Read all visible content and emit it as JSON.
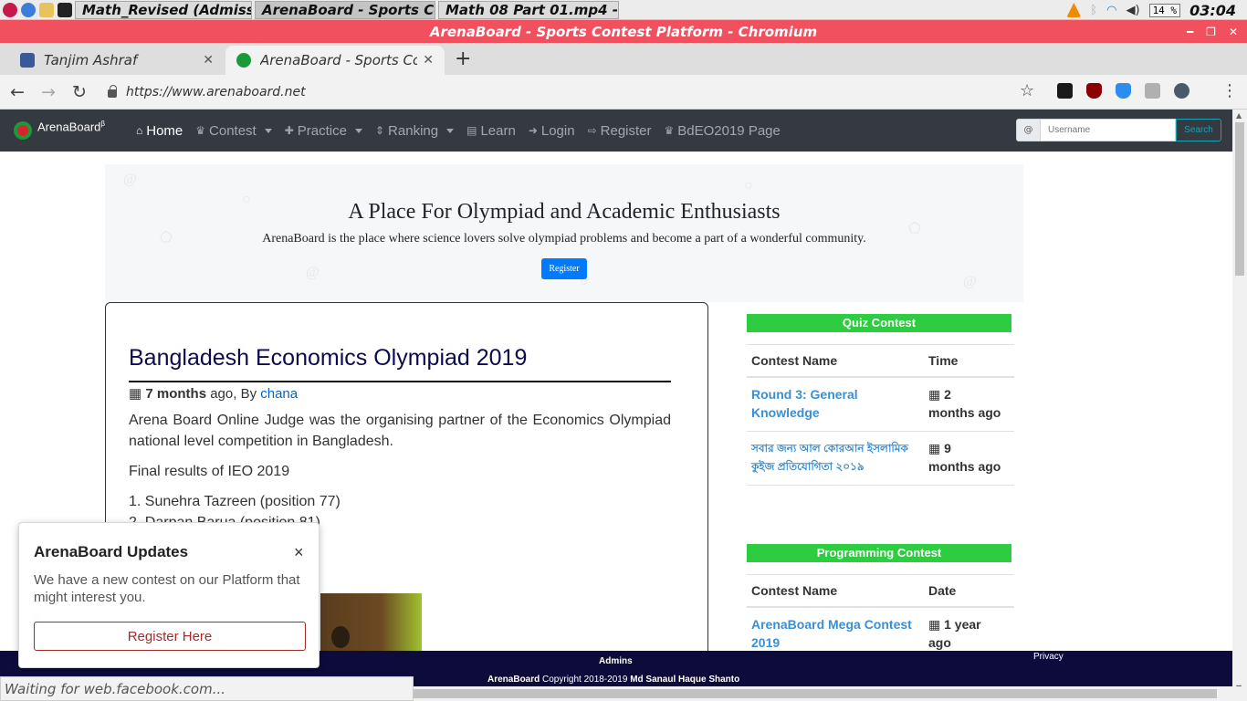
{
  "taskbar": {
    "tasks": [
      {
        "label": "Math_Revised (Admissi..."
      },
      {
        "label": "ArenaBoard - Sports Co..."
      },
      {
        "label": "Math 08 Part 01.mp4 - ..."
      }
    ],
    "battery": "14 %",
    "clock": "03:04"
  },
  "window": {
    "title": "ArenaBoard - Sports Contest Platform - Chromium"
  },
  "browser": {
    "tabs": [
      {
        "label": "Tanjim Ashraf"
      },
      {
        "label": "ArenaBoard - Sports Contest Platform"
      }
    ],
    "url": "https://www.arenaboard.net",
    "status": "Waiting for web.facebook.com..."
  },
  "nav": {
    "brand": "ArenaBoard",
    "brand_sup": "β",
    "links": [
      {
        "label": "Home",
        "icon": "home-icon"
      },
      {
        "label": "Contest",
        "icon": "trophy-icon"
      },
      {
        "label": "Practice",
        "icon": "puzzle-icon"
      },
      {
        "label": "Ranking",
        "icon": "sort-icon"
      },
      {
        "label": "Learn",
        "icon": "book-icon"
      },
      {
        "label": "Login",
        "icon": "sign-in-icon"
      },
      {
        "label": "Register",
        "icon": "sign-up-icon"
      },
      {
        "label": "BdEO2019 Page",
        "icon": "trophy-icon"
      }
    ],
    "search": {
      "addon": "@",
      "placeholder": "Username",
      "button": "Search"
    }
  },
  "hero": {
    "title": "A Place For Olympiad and Academic Enthusiasts",
    "subtitle": "ArenaBoard is the place where science lovers solve olympiad problems and become a part of a wonderful community.",
    "button": "Register"
  },
  "post": {
    "title": "Bangladesh Economics Olympiad 2019",
    "meta_age": "7 months",
    "meta_mid": " ago, By ",
    "meta_author": "chana",
    "para1": "Arena Board Online Judge was the organising partner of the Economics Olympiad national level competition in Bangladesh.",
    "para2": "Final results of IEO 2019",
    "item1": "1. Sunehra Tazreen (position 77)",
    "item2": "2. Darpan Barua (position 81)"
  },
  "quiz": {
    "header": "Quiz Contest",
    "col_name": "Contest Name",
    "col_time": "Time",
    "rows": [
      {
        "name": "Round 3: General Knowledge",
        "time": "2",
        "ago": "months ago"
      },
      {
        "name": "সবার জন্য আল কোরআন ইসলামিক কুইজ প্রতিযোগিতা ২০১৯",
        "time": "9",
        "ago": "months ago"
      }
    ]
  },
  "programming": {
    "header": "Programming Contest",
    "col_name": "Contest Name",
    "col_date": "Date",
    "rows": [
      {
        "name": "ArenaBoard Mega Contest 2019",
        "time": "1 year",
        "ago": "ago"
      }
    ]
  },
  "footer": {
    "admins": "Admins",
    "privacy": "Privacy",
    "copy_brand": "ArenaBoard",
    "copy_text": " Copyright 2018-2019 ",
    "copy_owner": "Md Sanaul Haque Shanto"
  },
  "toast": {
    "title": "ArenaBoard Updates",
    "close": "×",
    "message": "We have a new contest on our Platform that might interest you.",
    "button": "Register Here"
  },
  "colors": {
    "titlebar": "#f1505e",
    "navbar": "#343a40",
    "section_header": "#2ecc40",
    "footer": "#0d0b3b",
    "link": "#3b8fd1"
  }
}
